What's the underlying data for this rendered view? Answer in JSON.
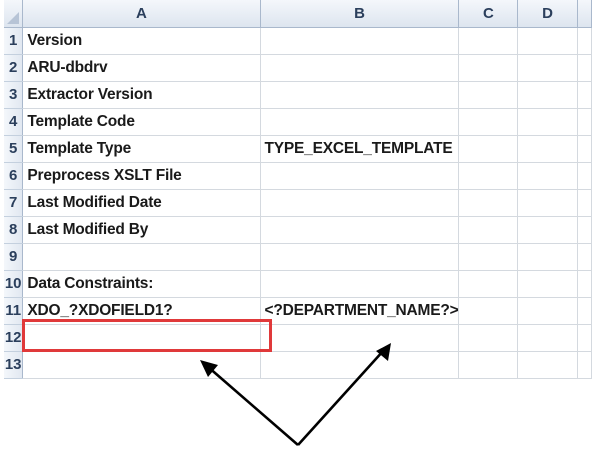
{
  "columns": [
    "A",
    "B",
    "C",
    "D"
  ],
  "rows": [
    {
      "num": "1",
      "a": "Version",
      "b": ""
    },
    {
      "num": "2",
      "a": "ARU-dbdrv",
      "b": ""
    },
    {
      "num": "3",
      "a": "Extractor Version",
      "b": ""
    },
    {
      "num": "4",
      "a": "Template Code",
      "b": ""
    },
    {
      "num": "5",
      "a": "Template Type",
      "b": "TYPE_EXCEL_TEMPLATE"
    },
    {
      "num": "6",
      "a": "Preprocess XSLT File",
      "b": ""
    },
    {
      "num": "7",
      "a": "Last Modified Date",
      "b": ""
    },
    {
      "num": "8",
      "a": "Last Modified By",
      "b": ""
    },
    {
      "num": "9",
      "a": "",
      "b": ""
    },
    {
      "num": "10",
      "a": "Data Constraints:",
      "b": ""
    },
    {
      "num": "11",
      "a": "XDO_?XDOFIELD1?",
      "b": "<?DEPARTMENT_NAME?>"
    },
    {
      "num": "12",
      "a": "",
      "b": ""
    },
    {
      "num": "13",
      "a": "",
      "b": ""
    }
  ],
  "colors": {
    "highlight_border": "#e0393a",
    "arrow": "#000000",
    "header_bg": "#dde5ef",
    "gridline": "#d4d9df"
  }
}
